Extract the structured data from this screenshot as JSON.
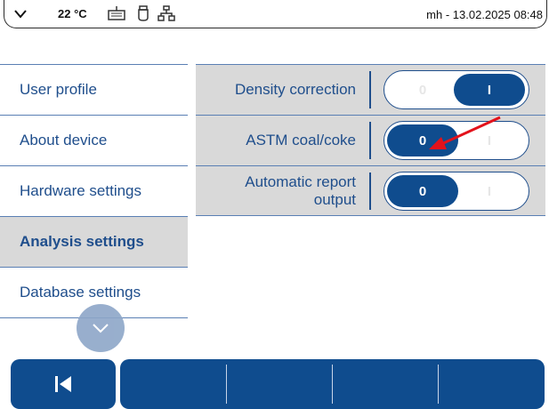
{
  "status": {
    "temperature": "22 °C",
    "user_datetime": "mh - 13.02.2025 08:48",
    "icons": [
      "chevron-down-icon",
      "keyboard-icon",
      "usb-icon",
      "network-icon"
    ]
  },
  "menu": {
    "items": [
      {
        "label": "User profile"
      },
      {
        "label": "About device"
      },
      {
        "label": "Hardware settings"
      },
      {
        "label": "Analysis settings",
        "active": true
      },
      {
        "label": "Database settings"
      }
    ]
  },
  "settings": {
    "rows": [
      {
        "label": "Density correction",
        "off_label": "0",
        "on_label": "I",
        "state": "I"
      },
      {
        "label": "ASTM coal/coke",
        "off_label": "0",
        "on_label": "I",
        "state": "0"
      },
      {
        "label_line1": "Automatic report",
        "label_line2": "output",
        "off_label": "0",
        "on_label": "I",
        "state": "0"
      }
    ]
  },
  "colors": {
    "accent": "#0f4c8e",
    "text": "#1f4e8c",
    "panel_bg": "#d9d9d9",
    "annotation_arrow": "#e3121b"
  }
}
